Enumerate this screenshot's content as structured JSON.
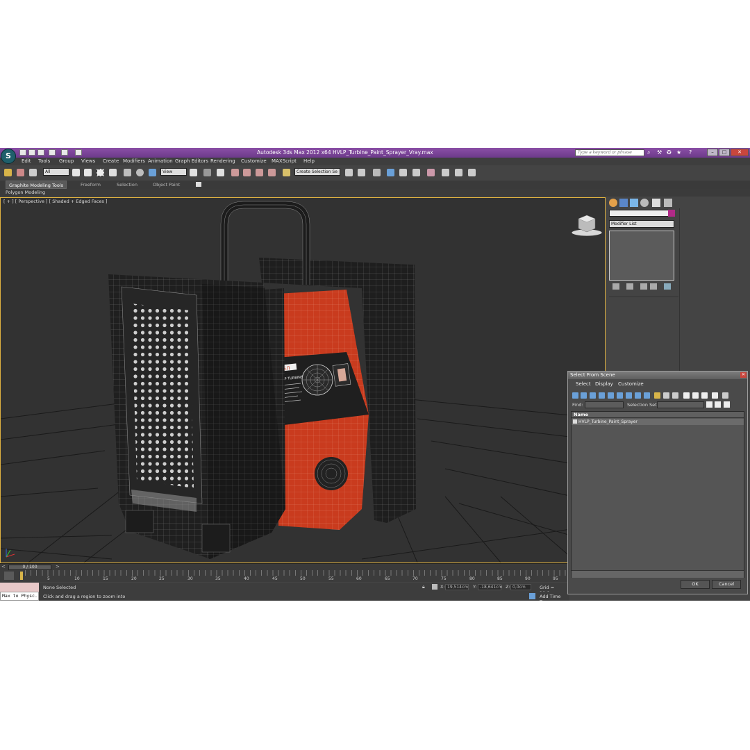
{
  "window": {
    "title": "Autodesk 3ds Max  2012 x64     HVLP_Turbine_Paint_Sprayer_Vray.max",
    "search_placeholder": "Type a keyword or phrase",
    "accent_color": "#7a449a"
  },
  "menu": [
    "Edit",
    "Tools",
    "Group",
    "Views",
    "Create",
    "Modifiers",
    "Animation",
    "Graph Editors",
    "Rendering",
    "Customize",
    "MAXScript",
    "Help"
  ],
  "toolbar": {
    "selection_filter": "All",
    "reference_coord": "View",
    "named_selection": "Create Selection Se"
  },
  "ribbon": {
    "tabs": [
      "Graphite Modeling Tools",
      "Freeform",
      "Selection",
      "Object Paint"
    ],
    "panel": "Polygon Modeling"
  },
  "viewport": {
    "label": "[ + ] [ Perspective ] [ Shaded + Edged Faces ]",
    "label_part_1": "Perspective",
    "label_part_2": "Shaded + Edged Faces"
  },
  "command_panel": {
    "modifier_list": "Modifier List"
  },
  "timeline": {
    "frame_counter": "0 / 100",
    "ticks": [
      "5",
      "10",
      "15",
      "20",
      "25",
      "30",
      "35",
      "40",
      "45",
      "50",
      "55",
      "60",
      "65",
      "70",
      "75",
      "80",
      "85",
      "90",
      "95"
    ]
  },
  "status": {
    "selection": "None Selected",
    "prompt": "Click and drag a region to zoom into",
    "maxscript": "Max to Physc.",
    "x_value": "19,514cm",
    "y_value": "-18,641cm",
    "z_value": "0,0cm",
    "grid": "Grid = 10,0cm",
    "add_time_tag": "Add Time Tag"
  },
  "dialog": {
    "title": "Select From Scene",
    "menu": [
      "Select",
      "Display",
      "Customize"
    ],
    "find_label": "Find:",
    "selection_set_label": "Selection Set:",
    "column_name": "Name",
    "rows": [
      "HVLP_Turbine_Paint_Sprayer"
    ],
    "ok": "OK",
    "cancel": "Cancel"
  },
  "model": {
    "brand_text": "ВЕЛ",
    "model_text": "LP TURBINE",
    "body_color": "#c93b1e"
  }
}
